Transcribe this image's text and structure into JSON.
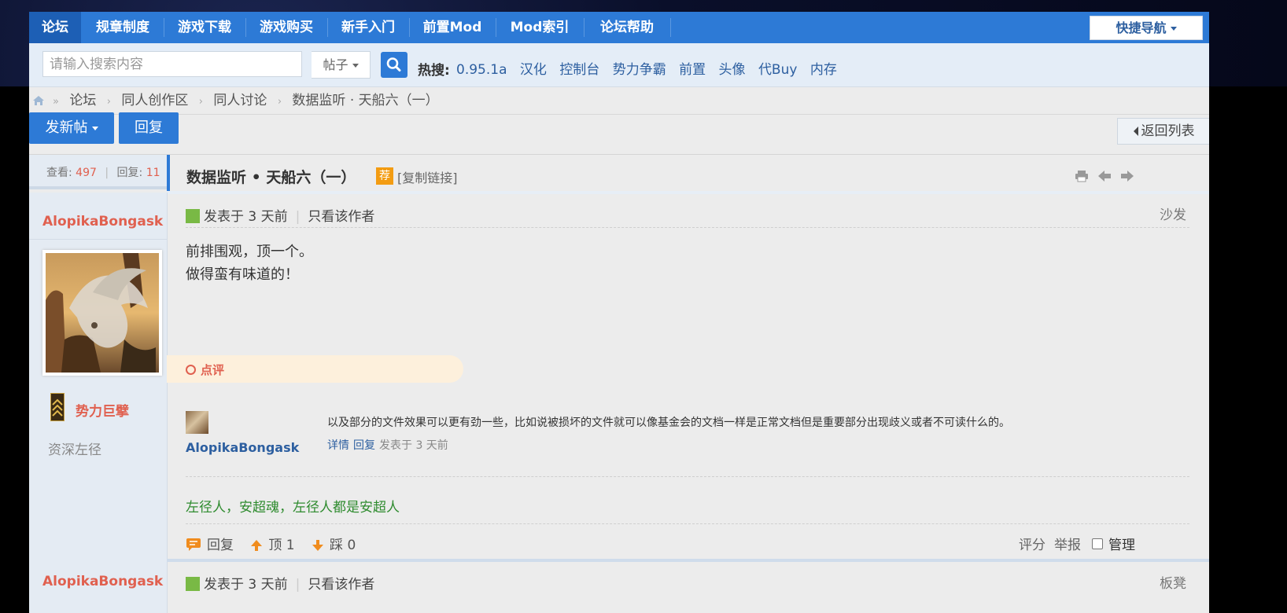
{
  "nav": {
    "items": [
      "论坛",
      "规章制度",
      "游戏下载",
      "游戏购买",
      "新手入门",
      "前置Mod",
      "Mod索引",
      "论坛帮助"
    ],
    "quick_nav": "快捷导航"
  },
  "search": {
    "placeholder": "请输入搜索内容",
    "type": "帖子",
    "hot_label": "热搜:",
    "hot_terms": [
      "0.95.1a",
      "汉化",
      "控制台",
      "势力争霸",
      "前置",
      "头像",
      "代Buy",
      "内存"
    ]
  },
  "breadcrumb": [
    "论坛",
    "同人创作区",
    "同人讨论",
    "数据监听 · 天船六（一）"
  ],
  "actions": {
    "new_post": "发新帖",
    "reply": "回复",
    "back_list": "返回列表"
  },
  "stats": {
    "views_label": "查看:",
    "views": "497",
    "replies_label": "回复:",
    "replies": "11"
  },
  "thread": {
    "title": "数据监听 • 天船六（一）",
    "rec_tag": "荐",
    "copy_link": "[复制链接]"
  },
  "post": {
    "author": "AlopikaBongask",
    "rank_name": "势力巨擘",
    "rank_title": "资深左径",
    "posted": "发表于 3 天前",
    "only_author": "只看该作者",
    "floor": "沙发",
    "body_lines": [
      "前排围观，顶一个。",
      "做得蛮有味道的！"
    ],
    "dianping": "点评",
    "comment": {
      "author": "AlopikaBongask",
      "text": "以及部分的文件效果可以更有劲一些，比如说被损坏的文件就可以像基金会的文档一样是正常文档但是重要部分出现歧义或者不可读什么的。",
      "detail": "详情",
      "reply": "回复",
      "time": "发表于 3 天前"
    },
    "signature": "左径人，安超魂，左径人都是安超人",
    "footer": {
      "reply": "回复",
      "up": "顶 1",
      "down": "踩 0",
      "rate": "评分",
      "report": "举报",
      "manage": "管理"
    }
  },
  "next_post": {
    "author": "AlopikaBongask",
    "posted": "发表于 3 天前",
    "only_author": "只看该作者",
    "floor": "板凳"
  },
  "colors": {
    "accent": "#2d7ad6",
    "author": "#e0604f",
    "signature": "#2e8b2e",
    "link": "#2d5fa0"
  }
}
